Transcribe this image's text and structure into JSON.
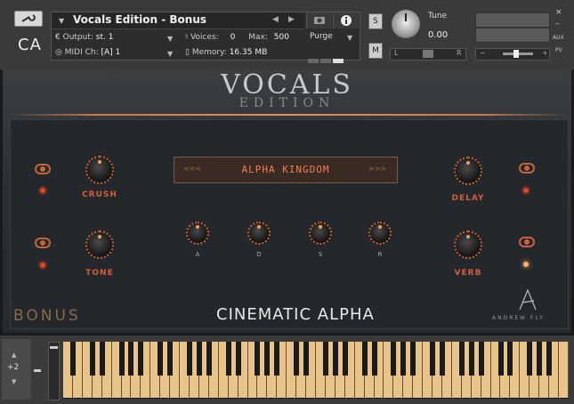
{
  "header": {
    "instrument_title": "Vocals Edition - Bonus",
    "output_label": "Output:",
    "output_value": "st. 1",
    "voices_label": "Voices:",
    "voices_value": "0",
    "max_label": "Max:",
    "max_value": "500",
    "midi_label": "MIDI Ch:",
    "midi_value": "[A]  1",
    "memory_label": "Memory:",
    "memory_value": "16.35 MB",
    "purge_label": "Purge",
    "solo_label": "S",
    "mute_label": "M",
    "tune_label": "Tune",
    "tune_value": "0.00",
    "pan_left": "L",
    "pan_right": "R",
    "aux_label": "AUX",
    "pv_label": "PV",
    "close_glyph": "×",
    "minimize_glyph": "–",
    "logo_text": "CA"
  },
  "panel": {
    "title": "VOCALS",
    "subtitle": "EDITION",
    "preset_name": "ALPHA KINGDOM",
    "preset_prev": "<<<",
    "preset_next": ">>>",
    "knobs_left": [
      {
        "label": "CRUSH"
      },
      {
        "label": "TONE"
      }
    ],
    "knobs_right": [
      {
        "label": "DELAY"
      },
      {
        "label": "VERB"
      }
    ],
    "adsr": [
      {
        "label": "A"
      },
      {
        "label": "D"
      },
      {
        "label": "S"
      },
      {
        "label": "R"
      }
    ],
    "bonus_label": "BONUS",
    "brand": "CINEMATIC ALPHA",
    "signature": "ANDREW FLY"
  },
  "keyboard": {
    "octave_value": "+2",
    "up_glyph": "▲",
    "down_glyph": "▼"
  },
  "colors": {
    "accent": "#d45d3a",
    "led": "#e04030",
    "keys": "#e8c48a"
  }
}
